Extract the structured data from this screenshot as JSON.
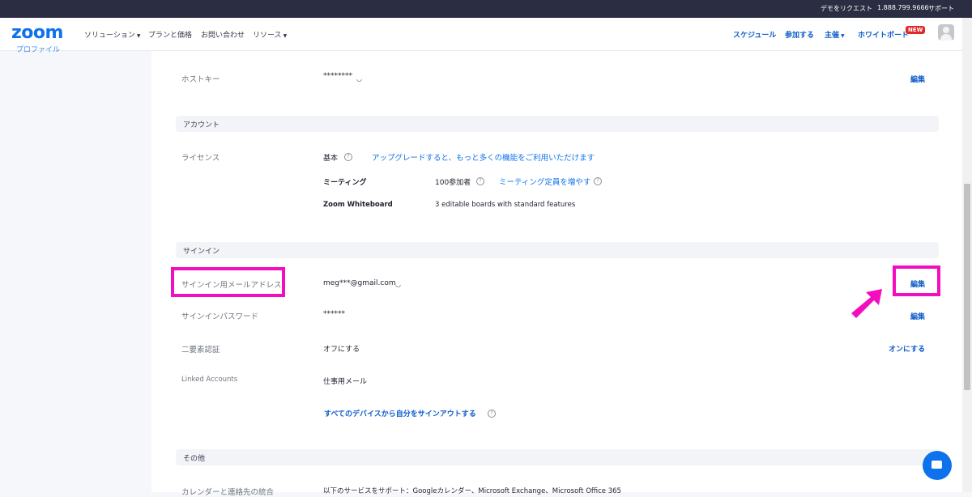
{
  "topbar": {
    "demo": "デモをリクエスト",
    "phone": "1.888.799.9666",
    "support": "サポート"
  },
  "nav": {
    "logo": "zoom",
    "solutions": "ソリューション",
    "pricing": "プランと価格",
    "contact": "お問い合わせ",
    "resources": "リソース",
    "schedule": "スケジュール",
    "join": "参加する",
    "host": "主催",
    "whiteboard": "ホワイトボード",
    "new_badge": "NEW"
  },
  "sidebar": {
    "fragment": "プロファイル"
  },
  "profile": {
    "host_key_label": "ホストキー",
    "host_key_value": "********",
    "host_key_edit": "編集",
    "account_section": "アカウント",
    "license_label": "ライセンス",
    "license_basic": "基本",
    "license_upgrade": "アップグレードすると、もっと多くの機能をご利用いただけます",
    "meeting_label": "ミーティング",
    "meeting_value": "100参加者",
    "meeting_link": "ミーティング定員を増やす",
    "whiteboard_label": "Zoom Whiteboard",
    "whiteboard_value": "3 editable boards with standard features",
    "signin_section": "サインイン",
    "signin_email_label": "サインイン用メールアドレス",
    "signin_email_value": "meg***@gmail.com",
    "signin_email_edit": "編集",
    "signin_password_label": "サインインパスワード",
    "signin_password_value": "******",
    "signin_password_edit": "編集",
    "twofa_label": "二要素認証",
    "twofa_value": "オフにする",
    "twofa_action": "オンにする",
    "linked_label": "Linked Accounts",
    "linked_value": "仕事用メール",
    "signout_all": "すべてのデバイスから自分をサインアウトする",
    "other_section": "その他",
    "calendar_label": "カレンダーと連絡先の統合",
    "calendar_value": "以下のサービスをサポート：Googleカレンダー、Microsoft Exchange、Microsoft Office 365"
  },
  "colors": {
    "accent": "#0e72ed",
    "highlight": "#f20dbf",
    "topbar": "#2b2d42"
  }
}
